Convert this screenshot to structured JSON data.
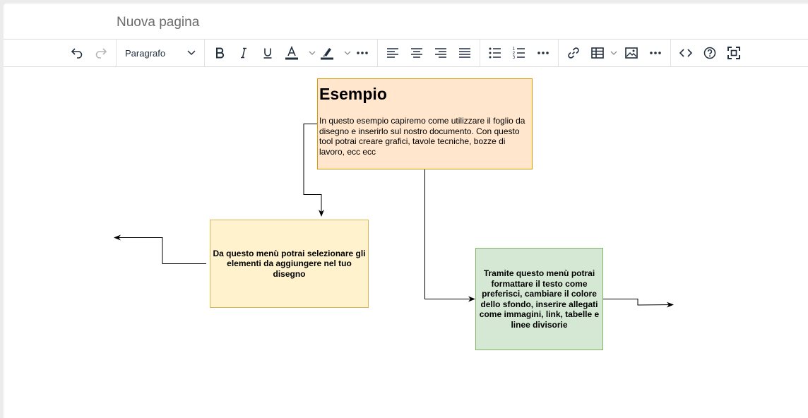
{
  "page": {
    "title": "Nuova pagina"
  },
  "toolbar": {
    "undo": "undo-icon",
    "redo": "redo-icon",
    "block_format": "Paragrafo",
    "bold": "bold-icon",
    "italic": "italic-icon",
    "underline": "underline-icon",
    "text_color": "text-color-icon",
    "highlight": "highlight-icon",
    "more": "more-icon",
    "align_left": "align-left-icon",
    "align_center": "align-center-icon",
    "align_right": "align-right-icon",
    "justify": "justify-icon",
    "bullet_list": "bullet-list-icon",
    "numbered_list": "numbered-list-icon",
    "link": "link-icon",
    "table": "table-icon",
    "image": "image-icon",
    "source_code": "code-icon",
    "help": "help-icon",
    "fullscreen": "fullscreen-icon",
    "colors": {
      "text_color_bar": "#222f3e",
      "highlight_bar": "#222f3e"
    }
  },
  "diagram": {
    "example_box": {
      "heading": "Esempio",
      "body": "In questo esempio capiremo come utilizzare il foglio da disegno e inserirlo sul nostro documento. Con questo tool potrai creare grafici, tavole tecniche, bozze di lavoro, ecc ecc",
      "fill": "#ffe6cc",
      "stroke": "#d79b00"
    },
    "insert_menu_box": {
      "text": "Da questo menù  potrai selezionare gli elementi da aggiungere nel tuo disegno",
      "fill": "#fff2cc",
      "stroke": "#d6b656"
    },
    "format_menu_box": {
      "text": "Tramite questo menù potrai formattare il testo come preferisci, cambiare il colore dello sfondo, inserire allegati come immagini, link, tabelle e linee divisorie",
      "fill": "#d5e8d4",
      "stroke": "#82b366"
    }
  }
}
